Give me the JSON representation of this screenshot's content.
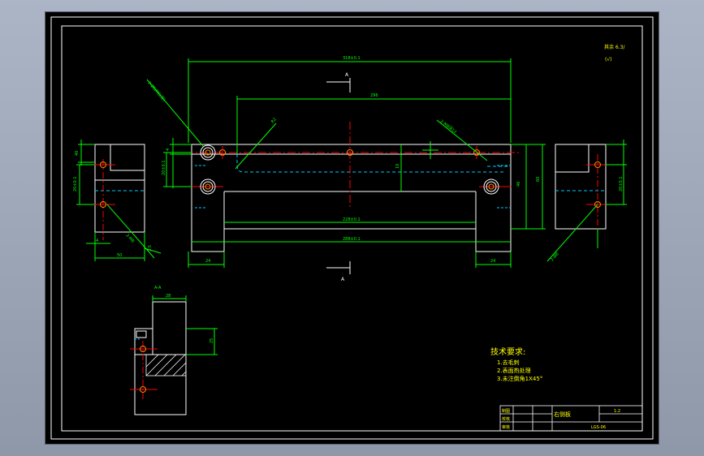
{
  "dims": {
    "overall_width": "318±0.1",
    "top_dim": "296",
    "bore_callout": "2-Ø8/M8(深)",
    "hole_callout_right": "2-M8深12",
    "inner_span_1": "228±0.1",
    "inner_span_2": "288±0.1",
    "small_r": "R2",
    "left_foot": "24",
    "right_foot": "24",
    "height_mid": "46",
    "height_total": "60",
    "left_view_width": "50",
    "left_view_height": "40",
    "left_view_pitch": "20±0.1",
    "right_view_pitch": "20±0.1",
    "hole_spec_left": "2-M8",
    "hole_spec_right": "2-Ø8",
    "chamfer": "1.5",
    "section_width": "28",
    "section_height": "25",
    "left_v1": "4",
    "left_v2": "10",
    "left_v3": "20±0.1",
    "sec_arrow": "A",
    "bottom_dim_a": "4",
    "bottom_dim_b": "4"
  },
  "labels": {
    "view_a_top": "A",
    "view_a_bottom": "A",
    "section_title": "A-A",
    "roughness": "其余 6.3/",
    "roughness_sub": "(√)"
  },
  "tech": {
    "title": "技术要求:",
    "item1": "1.去毛刺",
    "item2": "2.表面热处理",
    "item3": "3.未注倒角1X45°"
  },
  "titleblock": {
    "row1": "制图",
    "row2": "校核",
    "row3": "审核",
    "part_name": "右侧板",
    "scale": "1:2",
    "code": "LGS-06"
  },
  "colors": {
    "background": "#000000",
    "outline": "#ffffff",
    "dimension": "#00ff00",
    "centerline": "#ff0000",
    "hidden": "#00c8ff",
    "text": "#ffff00"
  }
}
